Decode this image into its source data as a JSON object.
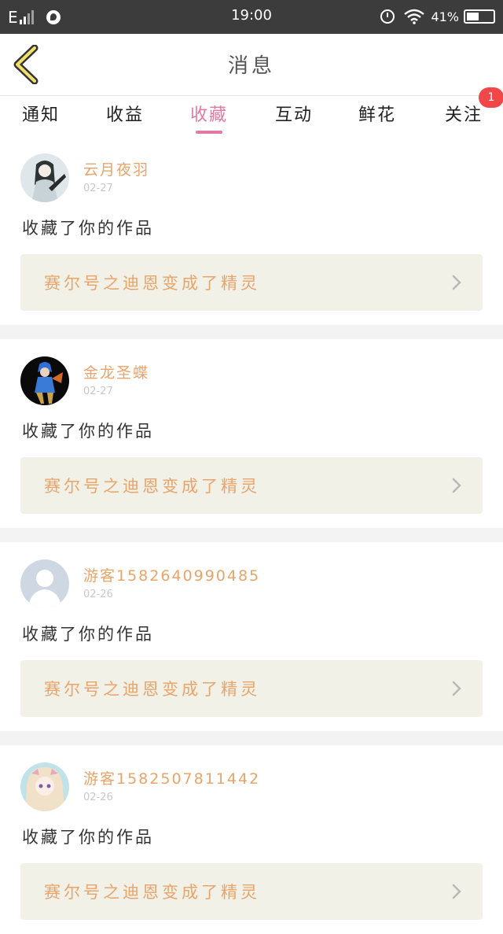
{
  "status_bar": {
    "network": "E",
    "time": "19:00",
    "battery_text": "41%",
    "battery_level": 0.41
  },
  "header": {
    "title": "消息",
    "back_icon": "chevron-left-icon"
  },
  "tabs": [
    {
      "label": "通知",
      "active": false
    },
    {
      "label": "收益",
      "active": false
    },
    {
      "label": "收藏",
      "active": true
    },
    {
      "label": "互动",
      "active": false
    },
    {
      "label": "鲜花",
      "active": false
    },
    {
      "label": "关注",
      "active": false,
      "badge": "1"
    }
  ],
  "items": [
    {
      "user": "云月夜羽",
      "date": "02-27",
      "action": "收藏了你的作品",
      "work": "赛尔号之迪恩变成了精灵"
    },
    {
      "user": "金龙圣蝶",
      "date": "02-27",
      "action": "收藏了你的作品",
      "work": "赛尔号之迪恩变成了精灵"
    },
    {
      "user": "游客1582640990485",
      "date": "02-26",
      "action": "收藏了你的作品",
      "work": "赛尔号之迪恩变成了精灵"
    },
    {
      "user": "游客1582507811442",
      "date": "02-26",
      "action": "收藏了你的作品",
      "work": "赛尔号之迪恩变成了精灵"
    }
  ],
  "colors": {
    "accent": "#e07aa0",
    "username": "#e8a46a",
    "card_bg": "#f2f1e7",
    "badge": "#f04848"
  }
}
